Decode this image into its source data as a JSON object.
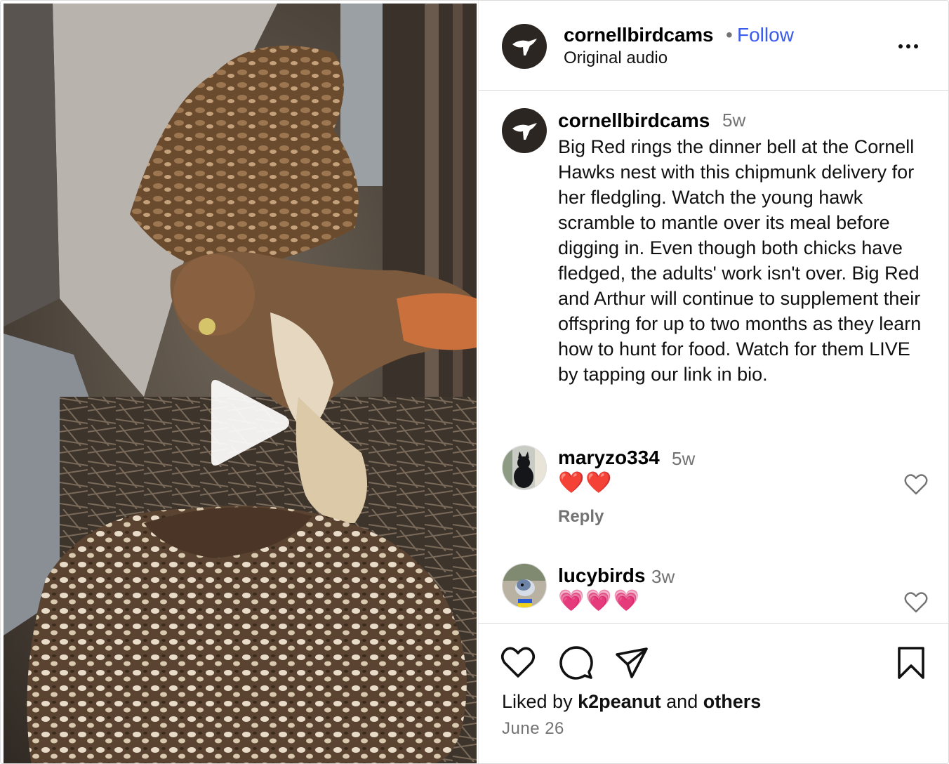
{
  "header": {
    "username": "cornellbirdcams",
    "separator": "•",
    "follow_label": "Follow",
    "audio_label": "Original audio"
  },
  "caption": {
    "username": "cornellbirdcams",
    "time": "5w",
    "text": "Big Red rings the dinner bell at the Cornell Hawks nest with this chipmunk delivery for her fledgling. Watch the young hawk scramble to mantle over its meal before digging in. Even though both chicks have fledged, the adults' work isn't over. Big Red and Arthur will continue to supplement their offspring for up to two months as they learn how to hunt for food. Watch for them LIVE by tapping our link in bio."
  },
  "comments": [
    {
      "username": "maryzo334",
      "time": "5w",
      "text": "❤️❤️",
      "reply_label": "Reply"
    },
    {
      "username": "lucybirds",
      "time": "3w",
      "text": "💗💗💗"
    }
  ],
  "likes": {
    "prefix": "Liked by",
    "user": "k2peanut",
    "conjunction": "and",
    "others": "others"
  },
  "date": "June 26",
  "icons": {
    "play": "play-icon",
    "more": "more-options-icon",
    "like": "heart-icon",
    "comment": "comment-icon",
    "share": "share-icon",
    "save": "bookmark-icon"
  },
  "colors": {
    "follow": "#3a5af0",
    "secondary_text": "#737373",
    "border": "#dbdbdb",
    "avatar_bg": "#2c2622"
  }
}
